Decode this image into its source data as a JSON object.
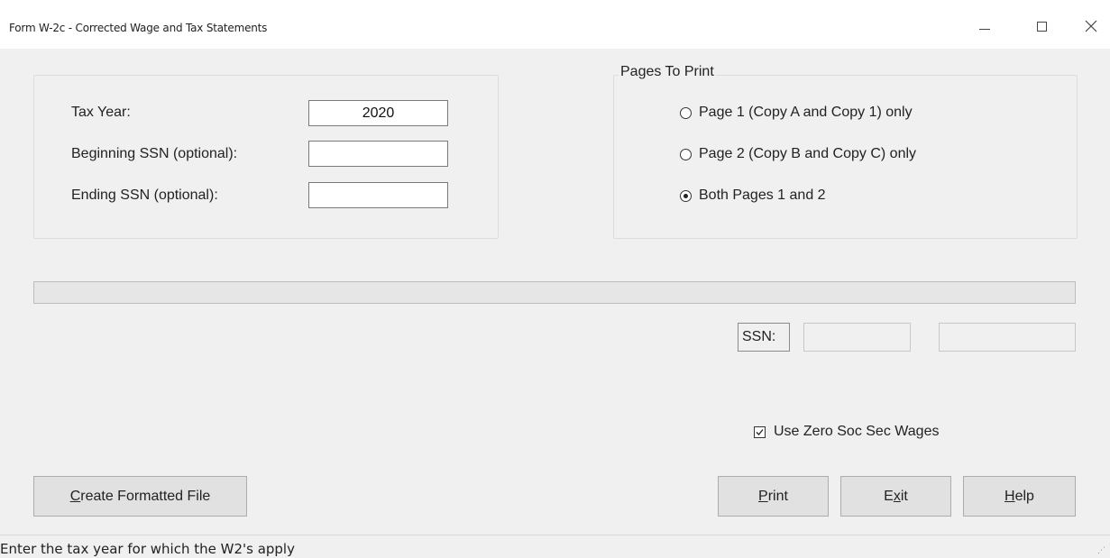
{
  "window": {
    "title": "Form W-2c - Corrected Wage and Tax Statements",
    "controls": {
      "minimize": "minimize-icon",
      "maximize": "maximize-icon",
      "close": "close-icon"
    }
  },
  "filters": {
    "tax_year_label": "Tax Year:",
    "tax_year_value": "2020",
    "begin_ssn_label": "Beginning SSN (optional):",
    "begin_ssn_value": "",
    "end_ssn_label": "Ending SSN (optional):",
    "end_ssn_value": ""
  },
  "pages_to_print": {
    "legend": "Pages To Print",
    "options": [
      {
        "label": "Page 1 (Copy A and Copy 1) only",
        "selected": false
      },
      {
        "label": "Page 2 (Copy B and Copy C) only",
        "selected": false
      },
      {
        "label": "Both Pages 1 and 2",
        "selected": true
      }
    ]
  },
  "progress": {
    "fraction": 0
  },
  "ssn_display": {
    "label": "SSN:",
    "value1": "",
    "value2": ""
  },
  "use_zero_soc_sec": {
    "label": "Use Zero Soc Sec Wages",
    "checked": true
  },
  "buttons": {
    "create": {
      "label": "Create Formatted File",
      "mnemonic": "C",
      "rest": "reate Formatted File"
    },
    "print": {
      "label": "Print",
      "mnemonic": "P",
      "rest": "rint"
    },
    "exit": {
      "label": "Exit",
      "pre": "E",
      "mnemonic": "x",
      "rest": "it"
    },
    "help": {
      "label": "Help",
      "mnemonic": "H",
      "rest": "elp"
    }
  },
  "status_bar": {
    "text": "Enter the tax year for which the W2's apply"
  }
}
